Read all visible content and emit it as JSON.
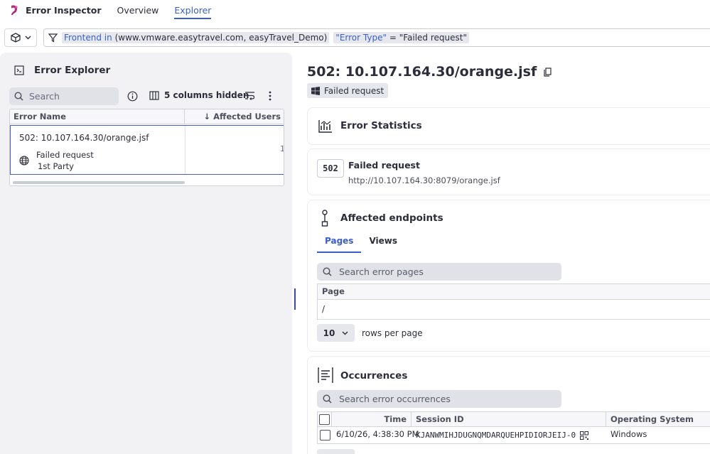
{
  "nav": {
    "app_name": "Error Inspector",
    "tabs": [
      "Overview",
      "Explorer"
    ],
    "active_tab": "Explorer"
  },
  "filter": {
    "token1_key": "Frontend",
    "token1_op": "in",
    "token1_value": "(www.vmware.easytravel.com, easyTravel_Demo)",
    "token2_key": "\"Error Type\"",
    "token2_op": "=",
    "token2_value": "\"Failed request\""
  },
  "explorer": {
    "title": "Error Explorer",
    "search_placeholder": "Search",
    "columns_hidden": "5 columns hidden",
    "col_error_name": "Error Name",
    "col_affected_users": "Affected Users",
    "row": {
      "name": "502: 10.107.164.30/orange.jsf",
      "type": "Failed request",
      "party": "1st Party",
      "count": "1"
    }
  },
  "detail": {
    "title": "502: 10.107.164.30/orange.jsf",
    "type_tag": "Failed request",
    "stats_title": "Error Statistics",
    "code": "502",
    "request_title": "Failed request",
    "request_url": "http://10.107.164.30:8079/orange.jsf",
    "endpoints_title": "Affected endpoints",
    "tabs": [
      "Pages",
      "Views"
    ],
    "pages_search_placeholder": "Search error pages",
    "pages_col": "Page",
    "pages_rows": [
      "/"
    ],
    "rows_per_page_value": "10",
    "rows_per_page_label": "rows per page",
    "occurrences_title": "Occurrences",
    "occ_search_placeholder": "Search error occurrences",
    "occ_cols": {
      "time": "Time",
      "session": "Session ID",
      "os": "Operating System"
    },
    "occ_rows": [
      {
        "time": "6/10/26, 4:38:30 PM",
        "session": "KJANWMIHJDUGNQMDARQUEHPIDIORJEIJ-0",
        "os": "Windows"
      }
    ]
  },
  "colors": {
    "accent": "#3a5fcd",
    "logo": "#b3277f",
    "panel_bg": "#f2f2f4"
  }
}
